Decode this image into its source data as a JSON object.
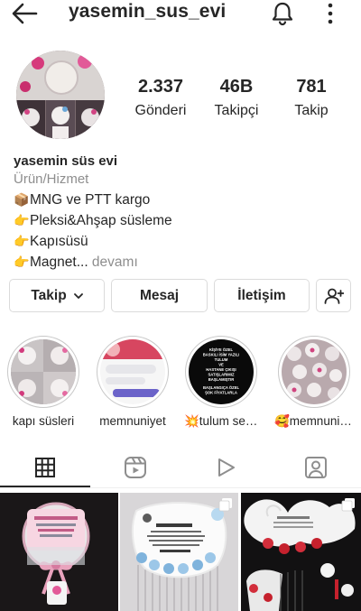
{
  "header": {
    "username": "yasemin_sus_evi",
    "icons": {
      "back": "arrow-left-icon",
      "notifications": "bell-icon",
      "more": "more-vertical-icon"
    }
  },
  "profile": {
    "stats": {
      "posts": {
        "value": "2.337",
        "label": "Gönderi"
      },
      "followers": {
        "value": "46B",
        "label": "Takipçi"
      },
      "following": {
        "value": "781",
        "label": "Takip"
      }
    },
    "bio": {
      "name": "yasemin süs evi",
      "category": "Ürün/Hizmet",
      "lines": [
        {
          "emoji": "📦",
          "text": "MNG ve PTT kargo"
        },
        {
          "emoji": "👉",
          "text": "Pleksi&Ahşap süsleme"
        },
        {
          "emoji": "👉",
          "text": "Kapısüsü"
        },
        {
          "emoji": "👉",
          "text": "Magnet"
        }
      ],
      "ellipsis": "...",
      "more_label": " devamı"
    }
  },
  "actions": {
    "follow": "Takip",
    "message": "Mesaj",
    "contact": "İletişim",
    "icons": {
      "follow_dropdown": "chevron-down-icon",
      "suggest": "add-person-icon"
    }
  },
  "highlights": [
    {
      "label": "kapı süsleri"
    },
    {
      "label": "memnuniyet"
    },
    {
      "label": "💥tulum seti💥"
    },
    {
      "label": "🥰memnuniy..."
    }
  ],
  "highlight_texts": {
    "h3": [
      "KİŞİYE ÖZEL",
      "BASKILI İSİM YAZILI",
      "TULUM",
      "VE",
      "HASTANE ÇIKIŞI",
      "SATIŞLARIMIZ",
      "BAŞLAMIŞTIR",
      "",
      "BAŞLANGIÇA ÖZEL",
      "ŞOK FİYATLARLA"
    ]
  },
  "tabs": [
    {
      "name": "grid",
      "icon": "grid-icon",
      "active": true
    },
    {
      "name": "reels",
      "icon": "reels-icon",
      "active": false
    },
    {
      "name": "videos",
      "icon": "play-icon",
      "active": false
    },
    {
      "name": "tagged",
      "icon": "tagged-person-icon",
      "active": false
    }
  ],
  "posts": [
    {
      "multiple": false
    },
    {
      "multiple": true
    },
    {
      "multiple": true
    }
  ],
  "colors": {
    "text": "#262626",
    "secondary": "#8e8e8e",
    "border": "#dbdbdb",
    "background": "#ffffff"
  }
}
